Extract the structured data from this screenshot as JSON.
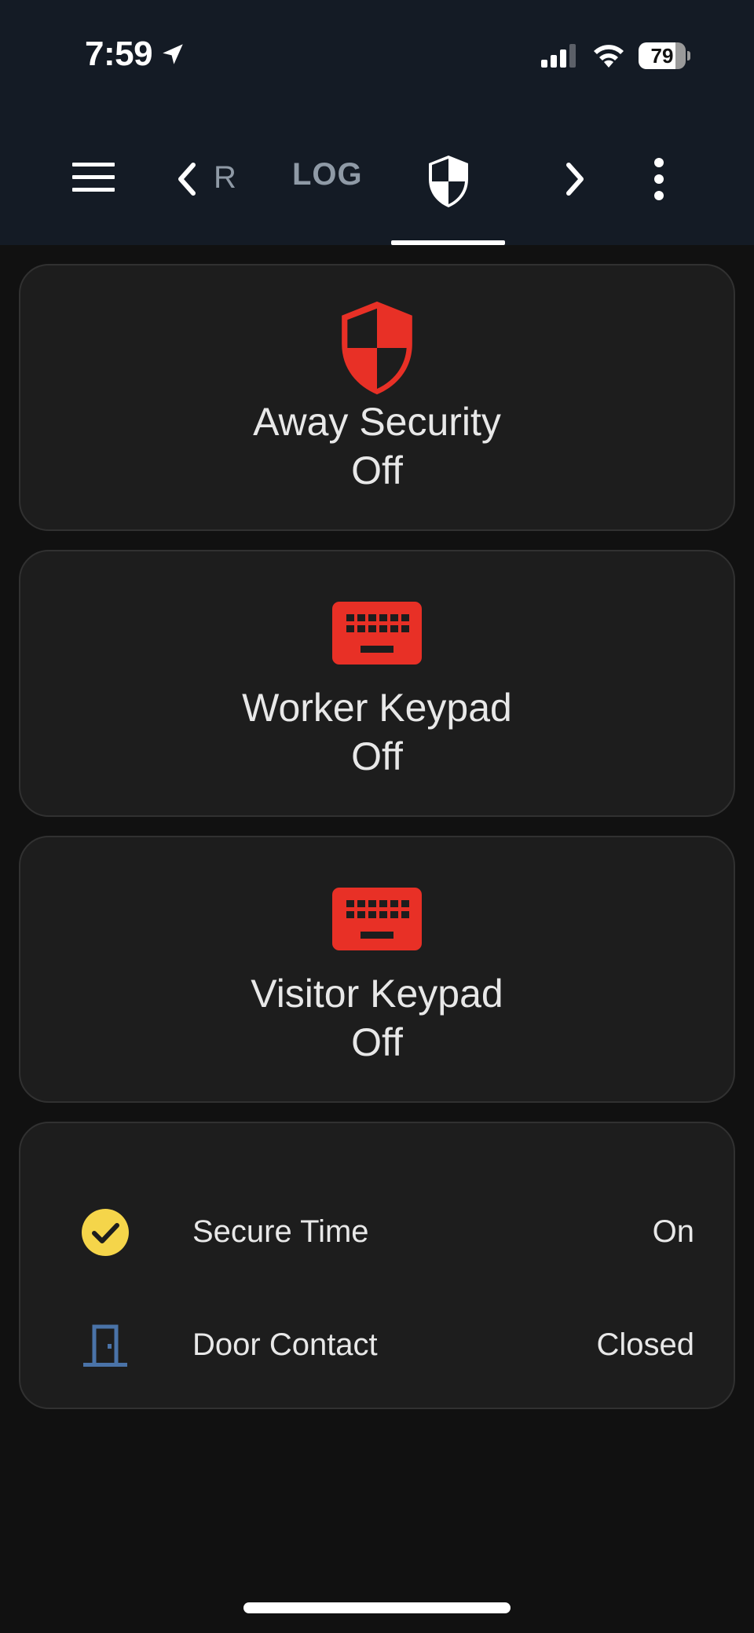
{
  "status_bar": {
    "time": "7:59",
    "battery_level": "79",
    "battery_fraction": 0.79
  },
  "nav": {
    "prev_tab_partial": "R",
    "log_tab": "LOG",
    "active_tab_icon": "shield-half-icon"
  },
  "colors": {
    "topbar": "#141b25",
    "background": "#111111",
    "card": "#1d1d1d",
    "accent_red": "#e83026",
    "check_yellow": "#f5d54a",
    "door_blue": "#4a73a8"
  },
  "cards": [
    {
      "name": "Away Security",
      "state": "Off",
      "icon": "shield-half-icon"
    },
    {
      "name": "Worker Keypad",
      "state": "Off",
      "icon": "keyboard-icon"
    },
    {
      "name": "Visitor Keypad",
      "state": "Off",
      "icon": "keyboard-icon"
    }
  ],
  "entities": [
    {
      "name": "Secure Time",
      "state": "On",
      "icon": "check-circle-icon"
    },
    {
      "name": "Door Contact",
      "state": "Closed",
      "icon": "door-closed-icon"
    }
  ]
}
